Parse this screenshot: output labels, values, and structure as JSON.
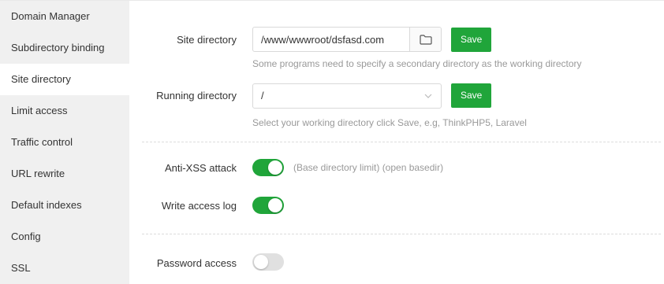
{
  "sidebar": {
    "items": [
      {
        "label": "Domain Manager"
      },
      {
        "label": "Subdirectory binding"
      },
      {
        "label": "Site directory"
      },
      {
        "label": "Limit access"
      },
      {
        "label": "Traffic control"
      },
      {
        "label": "URL rewrite"
      },
      {
        "label": "Default indexes"
      },
      {
        "label": "Config"
      },
      {
        "label": "SSL"
      }
    ],
    "active_item": "Site directory"
  },
  "site_directory": {
    "label": "Site directory",
    "value": "/www/wwwroot/dsfasd.com",
    "folder_icon": "folder-icon",
    "save_label": "Save",
    "hint": "Some programs need to specify a secondary directory as the working directory"
  },
  "running_directory": {
    "label": "Running directory",
    "value": "/",
    "dropdown_icon": "chevron-down-icon",
    "save_label": "Save",
    "hint": "Select your working directory click Save, e.g, ThinkPHP5, Laravel"
  },
  "anti_xss": {
    "label": "Anti-XSS attack",
    "enabled": true,
    "note": "(Base directory limit) (open basedir)"
  },
  "write_access_log": {
    "label": "Write access log",
    "enabled": true
  },
  "password_access": {
    "label": "Password access",
    "enabled": false
  },
  "colors": {
    "accent": "#20a53a",
    "sidebar_bg": "#f0f0f0",
    "hint_text": "#999999",
    "toggle_off": "#e0e0e0"
  }
}
